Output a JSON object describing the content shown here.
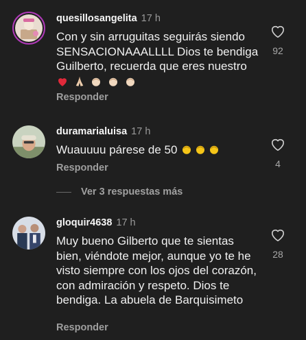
{
  "comments": [
    {
      "username": "quesillosangelita",
      "time": "17 h",
      "text": "Con y sin arruguitas seguirás siendo SENSACIONAAALLLL Dios te bendiga Guilberto, recuerda que eres nuestro",
      "emojis": [
        "heart-icon",
        "praying-hands-icon",
        "clapping-hands-icon",
        "clapping-hands-icon",
        "clapping-hands-icon"
      ],
      "likes": "92",
      "reply_label": "Responder"
    },
    {
      "username": "duramarialuisa",
      "time": "17 h",
      "text": "Wuauuuu párese de 50",
      "emojis": [
        "clapping-hands-icon",
        "clapping-hands-icon",
        "clapping-hands-icon"
      ],
      "likes": "4",
      "reply_label": "Responder"
    },
    {
      "username": "gloquir4638",
      "time": "17 h",
      "text": "Muy bueno Gilberto que te sientas bien, viéndote mejor, aunque yo te he visto siempre con los ojos del corazón, con admiración y respeto. Dios te bendiga. La abuela de Barquisimeto",
      "likes": "28",
      "reply_label": "Responder"
    }
  ],
  "view_replies": "Ver 3 respuestas más",
  "colors": {
    "background": "#1f1f1f",
    "story_ring": "#b03ab8",
    "clap_yellow": "#f5c518",
    "heart_red": "#e0293a"
  }
}
